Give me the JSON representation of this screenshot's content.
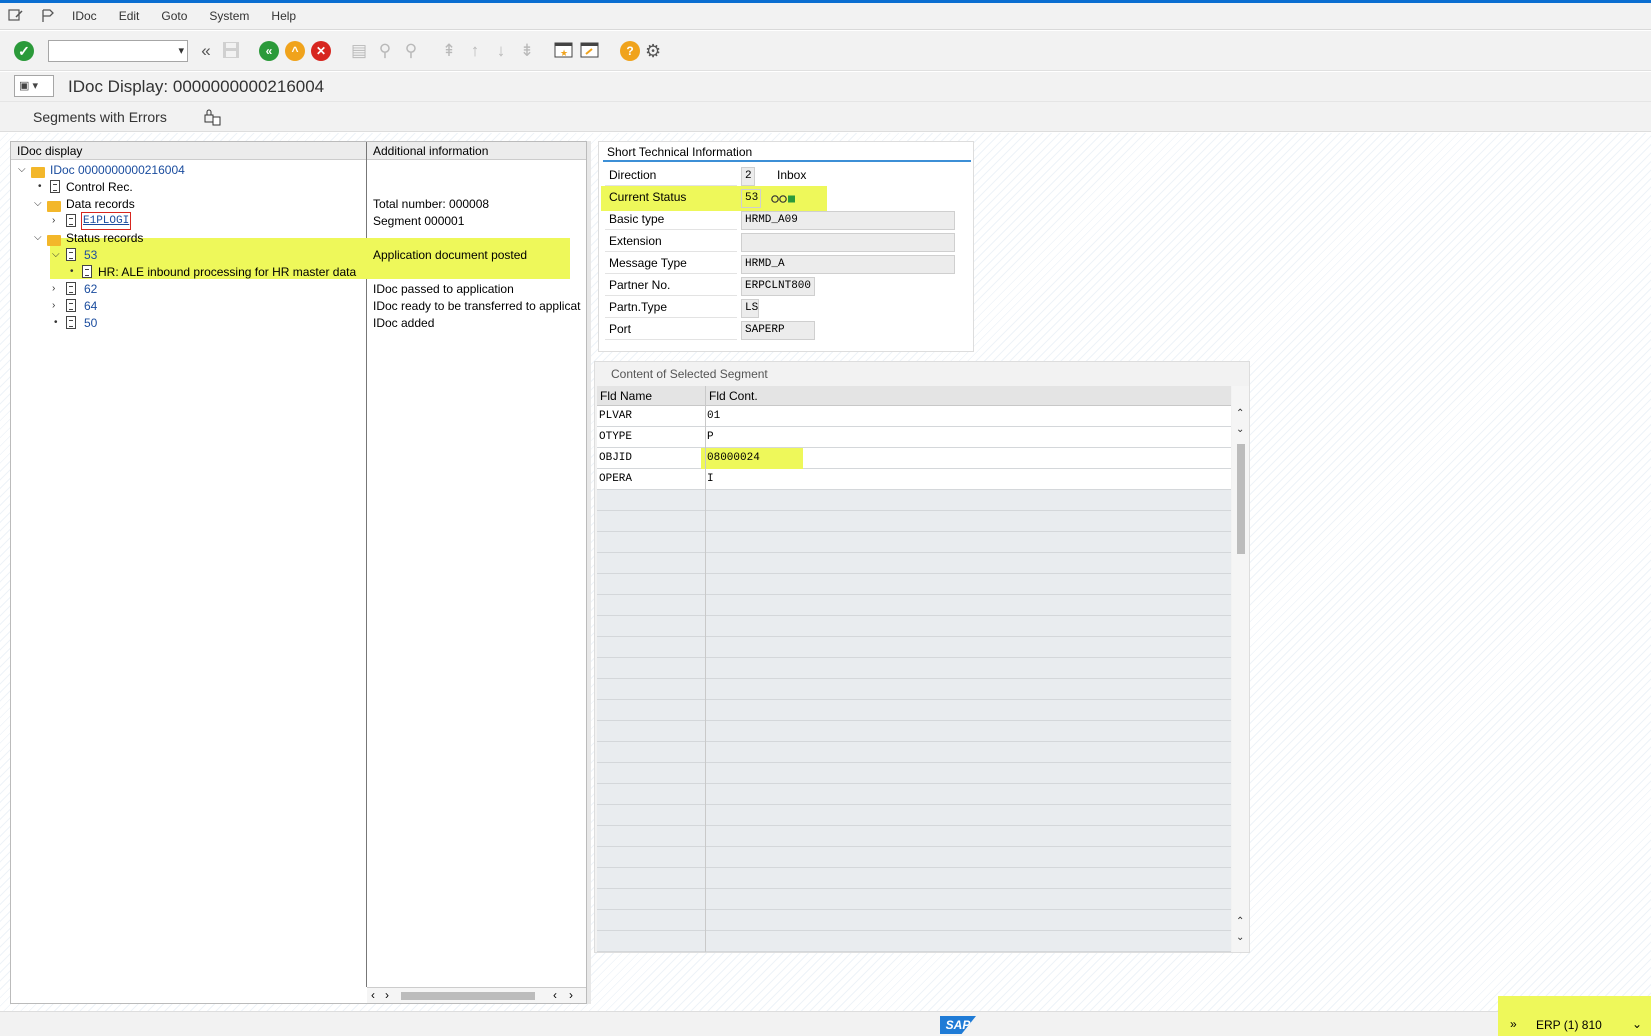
{
  "menu": {
    "items": [
      "IDoc",
      "Edit",
      "Goto",
      "System",
      "Help"
    ]
  },
  "title": "IDoc Display: 0000000000216004",
  "app_toolbar": {
    "button_label": "Segments with Errors"
  },
  "tree": {
    "col_header_1": "IDoc display",
    "col_header_2": "Additional information",
    "root": "IDoc 0000000000216004",
    "control": "Control Rec.",
    "data_records": "Data records",
    "data_info": "Total number: 000008",
    "segment": "E1PLOGI",
    "segment_info": "Segment 000001",
    "status_records": "Status records",
    "status": [
      {
        "code": "53",
        "info": "Application document posted",
        "child": "HR: ALE inbound processing for HR master data"
      },
      {
        "code": "62",
        "info": "IDoc passed to application"
      },
      {
        "code": "64",
        "info": "IDoc ready to be transferred to applicat"
      },
      {
        "code": "50",
        "info": "IDoc added"
      }
    ]
  },
  "short_tech_info": {
    "header": "Short Technical Information",
    "fields": [
      {
        "label": "Direction",
        "value": "2",
        "extra": "Inbox"
      },
      {
        "label": "Current Status",
        "value": "53",
        "extra": ""
      },
      {
        "label": "Basic type",
        "value": "HRMD_A09",
        "extra": ""
      },
      {
        "label": "Extension",
        "value": "",
        "extra": ""
      },
      {
        "label": "Message Type",
        "value": "HRMD_A",
        "extra": ""
      },
      {
        "label": "Partner No.",
        "value": "ERPCLNT800",
        "extra": ""
      },
      {
        "label": "Partn.Type",
        "value": "LS",
        "extra": ""
      },
      {
        "label": "Port",
        "value": "SAPERP",
        "extra": ""
      }
    ]
  },
  "segment_content": {
    "header": "Content of Selected Segment",
    "col1": "Fld Name",
    "col2": "Fld Cont.",
    "rows": [
      {
        "name": "PLVAR",
        "value": "01"
      },
      {
        "name": "OTYPE",
        "value": "P"
      },
      {
        "name": "OBJID",
        "value": "08000024"
      },
      {
        "name": "OPERA",
        "value": "I"
      }
    ]
  },
  "status_bar": {
    "system": "ERP (1) 810",
    "logo": "SAP"
  },
  "colors": {
    "highlight": "#eef85a",
    "link_blue": "#1a4c9e",
    "accent": "#0a6ed1"
  }
}
